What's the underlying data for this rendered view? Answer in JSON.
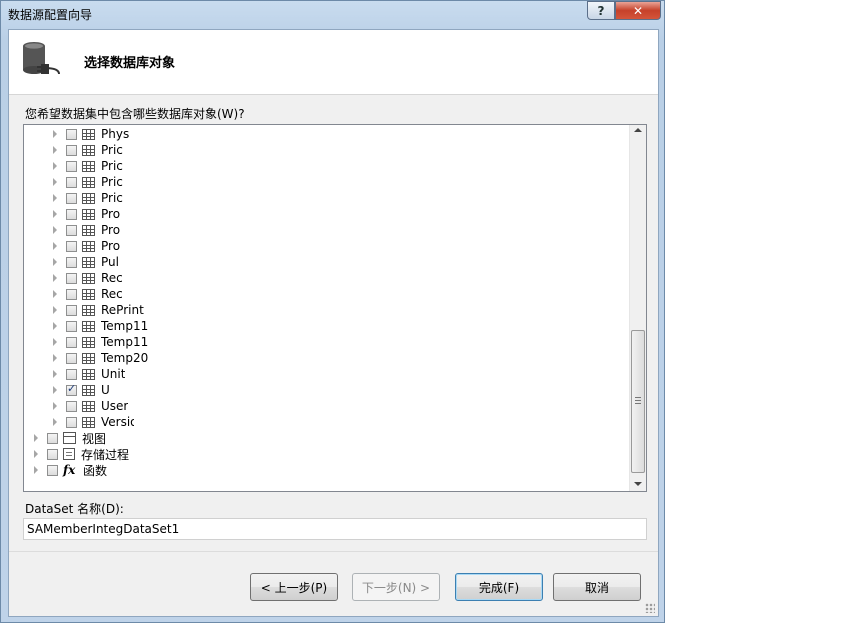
{
  "window": {
    "title": "数据源配置向导",
    "help_glyph": "?",
    "close_glyph": "✕"
  },
  "header": {
    "title": "选择数据库对象",
    "icon": "database-icon"
  },
  "tree_prompt": "您希望数据集中包含哪些数据库对象(W)?",
  "tree": {
    "tables": [
      {
        "label": "Phys",
        "checked": false
      },
      {
        "label": "Pric",
        "checked": false
      },
      {
        "label": "Pric",
        "checked": false
      },
      {
        "label": "Pric",
        "checked": false
      },
      {
        "label": "Pric",
        "checked": false
      },
      {
        "label": "Pro",
        "checked": false
      },
      {
        "label": "Pro",
        "checked": false
      },
      {
        "label": "Pro",
        "checked": false
      },
      {
        "label": "Pul",
        "checked": false
      },
      {
        "label": "Rec",
        "checked": false
      },
      {
        "label": "Rec",
        "checked": false
      },
      {
        "label": "RePrint",
        "checked": false
      },
      {
        "label": "Temp11",
        "checked": false
      },
      {
        "label": "Temp11",
        "checked": false
      },
      {
        "label": "Temp20",
        "checked": false
      },
      {
        "label": "Unit",
        "checked": false
      },
      {
        "label": "U",
        "checked": true
      },
      {
        "label": "User",
        "checked": false
      },
      {
        "label": "Versio",
        "checked": false
      }
    ],
    "groups": [
      {
        "label": "视图",
        "icon": "view-icon"
      },
      {
        "label": "存储过程",
        "icon": "stored-procedure-icon"
      },
      {
        "label": "函数",
        "icon": "function-icon"
      }
    ]
  },
  "dataset": {
    "label": "DataSet 名称(D):",
    "value": "SAMemberIntegDataSet1"
  },
  "buttons": {
    "back": "< 上一步(P)",
    "next": "下一步(N) >",
    "finish": "完成(F)",
    "cancel": "取消"
  }
}
